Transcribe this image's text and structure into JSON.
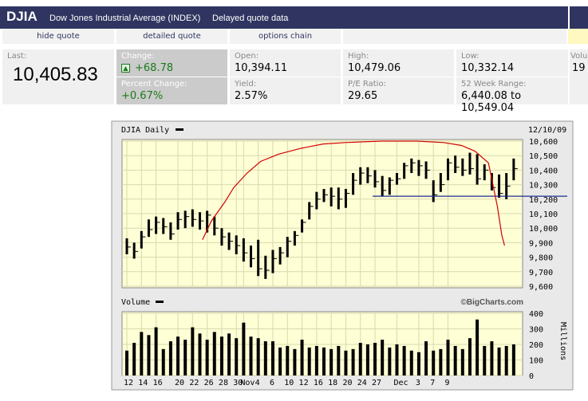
{
  "header": {
    "symbol": "DJIA",
    "name": "Dow Jones Industrial Average (INDEX)",
    "delay": "Delayed quote data"
  },
  "nav": {
    "hide_quote": "hide quote",
    "detailed_quote": "detailed quote",
    "options_chain": "options chain"
  },
  "quote": {
    "last_label": "Last:",
    "last_value": "10,405.83",
    "change_label": "Change:",
    "change_value": "+68.78",
    "pct_label": "Percent Change:",
    "pct_value": "+0.67%",
    "open_label": "Open:",
    "open_value": "10,394.11",
    "yield_label": "Yield:",
    "yield_value": "2.57%",
    "high_label": "High:",
    "high_value": "10,479.06",
    "pe_label": "P/E Ratio:",
    "pe_value": "29.65",
    "low_label": "Low:",
    "low_value": "10,332.14",
    "range_label": "52 Week Range:",
    "range_value": "6,440.08 to 10,549.04",
    "vol_label": "Volu",
    "vol_value": "19"
  },
  "chart_data": {
    "type": "bar",
    "title": "DJIA Daily",
    "date_label": "12/10/09",
    "volume_label": "Volume",
    "volume_unit": "Millions",
    "watermark": "©BigCharts.com",
    "price_ylim": [
      9600,
      10600
    ],
    "price_ticks": [
      "10,600",
      "10,500",
      "10,400",
      "10,300",
      "10,200",
      "10,100",
      "10,000",
      "9,900",
      "9,800",
      "9,700",
      "9,600"
    ],
    "volume_ylim": [
      0,
      400
    ],
    "volume_ticks": [
      "400",
      "300",
      "200",
      "100",
      "0"
    ],
    "x_ticks": [
      "12",
      "14",
      "16",
      "20",
      "22",
      "26",
      "28",
      "30",
      "Nov",
      "4",
      "6",
      "10",
      "12",
      "16",
      "18",
      "20",
      "24",
      "27",
      "Dec",
      "3",
      "7",
      "9"
    ],
    "ohlc": [
      {
        "h": 9930,
        "l": 9820,
        "c": 9870
      },
      {
        "h": 9900,
        "l": 9790,
        "c": 9840
      },
      {
        "h": 9980,
        "l": 9860,
        "c": 9940
      },
      {
        "h": 10060,
        "l": 9940,
        "c": 9990
      },
      {
        "h": 10080,
        "l": 9960,
        "c": 10040
      },
      {
        "h": 10070,
        "l": 9960,
        "c": 10010
      },
      {
        "h": 10040,
        "l": 9920,
        "c": 9960
      },
      {
        "h": 10110,
        "l": 9990,
        "c": 10060
      },
      {
        "h": 10120,
        "l": 10000,
        "c": 10080
      },
      {
        "h": 10130,
        "l": 10010,
        "c": 10060
      },
      {
        "h": 10110,
        "l": 9990,
        "c": 10050
      },
      {
        "h": 10120,
        "l": 9970,
        "c": 10090
      },
      {
        "h": 10080,
        "l": 9950,
        "c": 10000
      },
      {
        "h": 10000,
        "l": 9880,
        "c": 9940
      },
      {
        "h": 9970,
        "l": 9850,
        "c": 9910
      },
      {
        "h": 9950,
        "l": 9820,
        "c": 9880
      },
      {
        "h": 9930,
        "l": 9770,
        "c": 9830
      },
      {
        "h": 9880,
        "l": 9730,
        "c": 9790
      },
      {
        "h": 9920,
        "l": 9670,
        "c": 9720
      },
      {
        "h": 9810,
        "l": 9650,
        "c": 9710
      },
      {
        "h": 9850,
        "l": 9690,
        "c": 9790
      },
      {
        "h": 9870,
        "l": 9750,
        "c": 9830
      },
      {
        "h": 9940,
        "l": 9800,
        "c": 9910
      },
      {
        "h": 9980,
        "l": 9880,
        "c": 9950
      },
      {
        "h": 10060,
        "l": 9970,
        "c": 10040
      },
      {
        "h": 10180,
        "l": 10060,
        "c": 10150
      },
      {
        "h": 10250,
        "l": 10130,
        "c": 10200
      },
      {
        "h": 10270,
        "l": 10180,
        "c": 10230
      },
      {
        "h": 10280,
        "l": 10150,
        "c": 10220
      },
      {
        "h": 10280,
        "l": 10130,
        "c": 10200
      },
      {
        "h": 10270,
        "l": 10140,
        "c": 10240
      },
      {
        "h": 10380,
        "l": 10230,
        "c": 10330
      },
      {
        "h": 10420,
        "l": 10300,
        "c": 10380
      },
      {
        "h": 10420,
        "l": 10310,
        "c": 10360
      },
      {
        "h": 10400,
        "l": 10280,
        "c": 10320
      },
      {
        "h": 10360,
        "l": 10220,
        "c": 10260
      },
      {
        "h": 10350,
        "l": 10230,
        "c": 10330
      },
      {
        "h": 10380,
        "l": 10300,
        "c": 10340
      },
      {
        "h": 10450,
        "l": 10340,
        "c": 10430
      },
      {
        "h": 10480,
        "l": 10380,
        "c": 10450
      },
      {
        "h": 10470,
        "l": 10360,
        "c": 10430
      },
      {
        "h": 10460,
        "l": 10340,
        "c": 10400
      },
      {
        "h": 10330,
        "l": 10180,
        "c": 10230
      },
      {
        "h": 10380,
        "l": 10250,
        "c": 10300
      },
      {
        "h": 10480,
        "l": 10330,
        "c": 10450
      },
      {
        "h": 10500,
        "l": 10380,
        "c": 10420
      },
      {
        "h": 10480,
        "l": 10360,
        "c": 10400
      },
      {
        "h": 10520,
        "l": 10370,
        "c": 10410
      },
      {
        "h": 10510,
        "l": 10300,
        "c": 10340
      },
      {
        "h": 10440,
        "l": 10330,
        "c": 10400
      },
      {
        "h": 10380,
        "l": 10260,
        "c": 10280
      },
      {
        "h": 10370,
        "l": 10210,
        "c": 10240
      },
      {
        "h": 10380,
        "l": 10200,
        "c": 10290
      },
      {
        "h": 10480,
        "l": 10330,
        "c": 10410
      }
    ],
    "volume": [
      160,
      210,
      280,
      260,
      310,
      170,
      220,
      250,
      230,
      310,
      270,
      230,
      280,
      250,
      270,
      240,
      340,
      250,
      240,
      220,
      220,
      180,
      190,
      170,
      230,
      180,
      190,
      180,
      170,
      190,
      160,
      170,
      210,
      200,
      210,
      230,
      180,
      200,
      190,
      160,
      150,
      220,
      160,
      170,
      230,
      190,
      170,
      240,
      360,
      190,
      220,
      180,
      190,
      200
    ],
    "support_line": 10220,
    "channel_curve": [
      [
        9920,
        18
      ],
      [
        10050,
        20
      ],
      [
        10180,
        23
      ],
      [
        10280,
        25
      ],
      [
        10380,
        28
      ],
      [
        10460,
        31
      ],
      [
        10510,
        35
      ],
      [
        10550,
        40
      ],
      [
        10580,
        45
      ],
      [
        10590,
        50
      ],
      [
        10600,
        58
      ],
      [
        10600,
        66
      ],
      [
        10590,
        72
      ],
      [
        10570,
        76
      ],
      [
        10530,
        79
      ],
      [
        10450,
        82
      ],
      [
        10300,
        83
      ],
      [
        10150,
        84
      ],
      [
        9950,
        85
      ],
      [
        9880,
        85.6
      ]
    ]
  }
}
